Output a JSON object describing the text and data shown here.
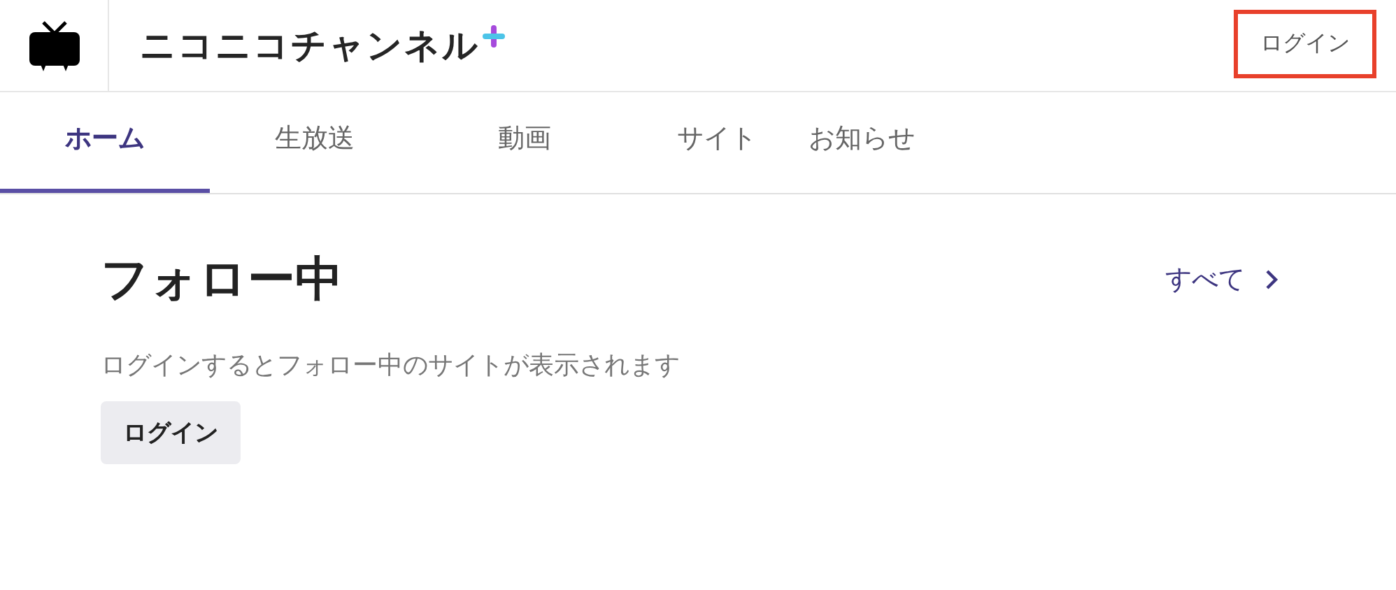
{
  "header": {
    "logo_text": "ニコニコチャンネル",
    "login_button": "ログイン"
  },
  "tabs": [
    {
      "label": "ホーム",
      "selected": true
    },
    {
      "label": "生放送",
      "selected": false
    },
    {
      "label": "動画",
      "selected": false
    },
    {
      "label": "サイト",
      "selected": false
    },
    {
      "label": "お知らせ",
      "selected": false
    }
  ],
  "following": {
    "title": "フォロー中",
    "see_all": "すべて",
    "message": "ログインするとフォロー中のサイトが表示されます",
    "login_button": "ログイン"
  }
}
